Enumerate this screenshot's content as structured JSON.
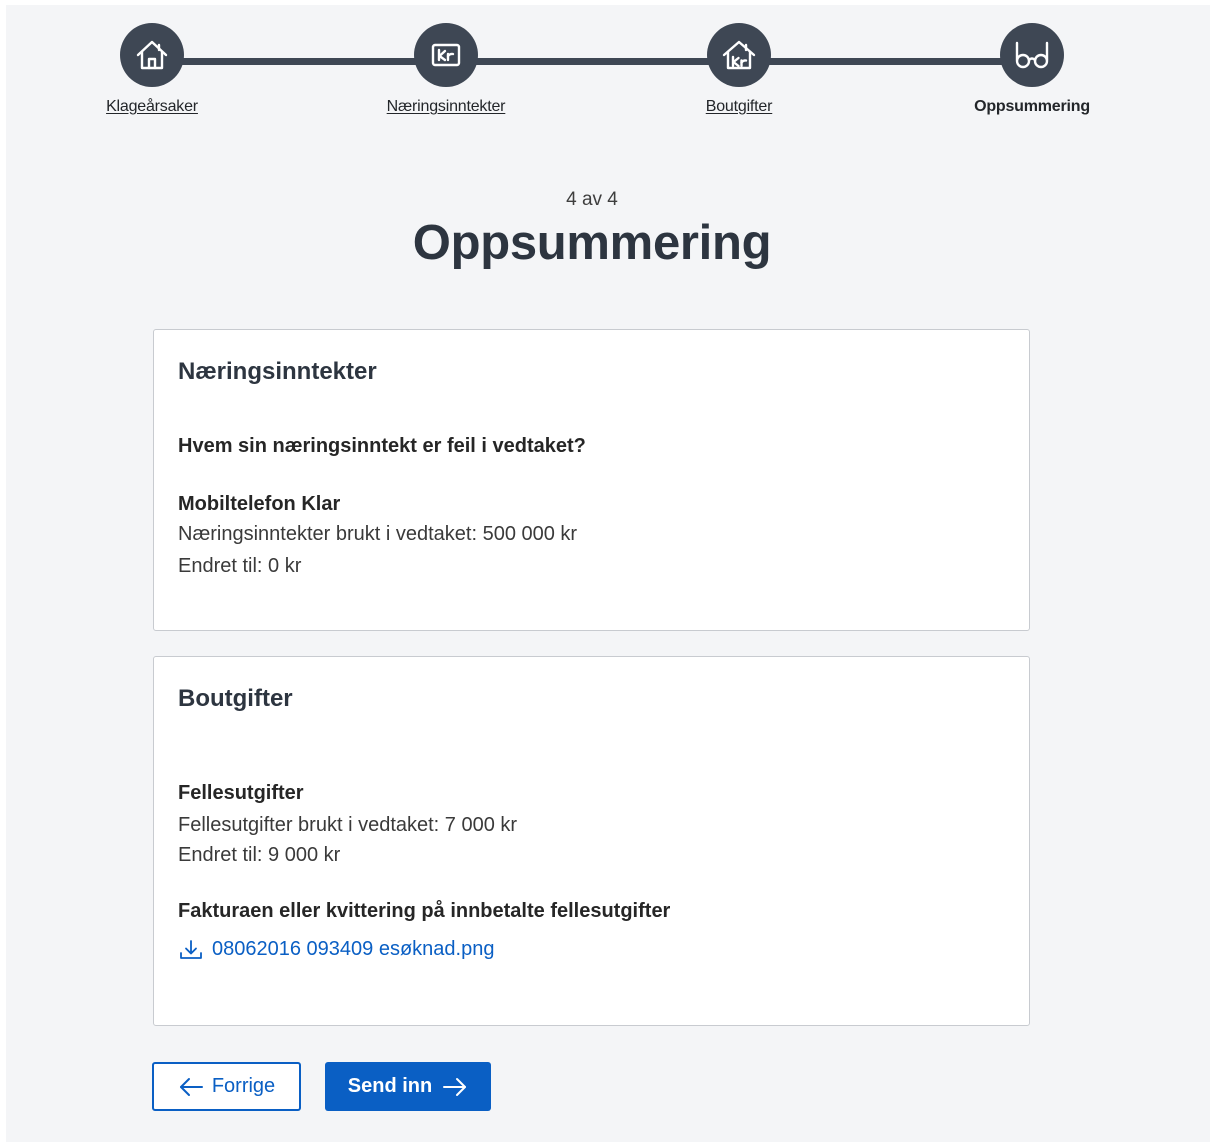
{
  "stepper": {
    "steps": [
      {
        "label": "Klageårsaker",
        "icon": "house-icon",
        "state": "completed"
      },
      {
        "label": "Næringsinntekter",
        "icon": "kr-box-icon",
        "state": "completed"
      },
      {
        "label": "Boutgifter",
        "icon": "house-kr-icon",
        "state": "completed"
      },
      {
        "label": "Oppsummering",
        "icon": "glasses-icon",
        "state": "current"
      }
    ]
  },
  "header": {
    "step_counter": "4 av 4",
    "title": "Oppsummering"
  },
  "sections": {
    "income": {
      "title": "Næringsinntekter",
      "question": "Hvem sin næringsinntekt er feil i vedtaket?",
      "person_name": "Mobiltelefon Klar",
      "used_line": "Næringsinntekter brukt i vedtaket: 500 000 kr",
      "changed_line": "Endret til: 0 kr"
    },
    "housing": {
      "title": "Boutgifter",
      "item_title": "Fellesutgifter",
      "used_line": "Fellesutgifter brukt i vedtaket: 7 000 kr",
      "changed_line": "Endret til: 9 000 kr",
      "attachment_title": "Fakturaen eller kvittering på innbetalte fellesutgifter",
      "attachment_file": "08062016 093409 esøknad.png"
    }
  },
  "buttons": {
    "previous": "Forrige",
    "submit": "Send inn"
  },
  "colors": {
    "stepper": "#3e4754",
    "primary": "#0a5fc4",
    "page_background": "#f4f5f7",
    "panel_border": "#c8cbd0"
  }
}
